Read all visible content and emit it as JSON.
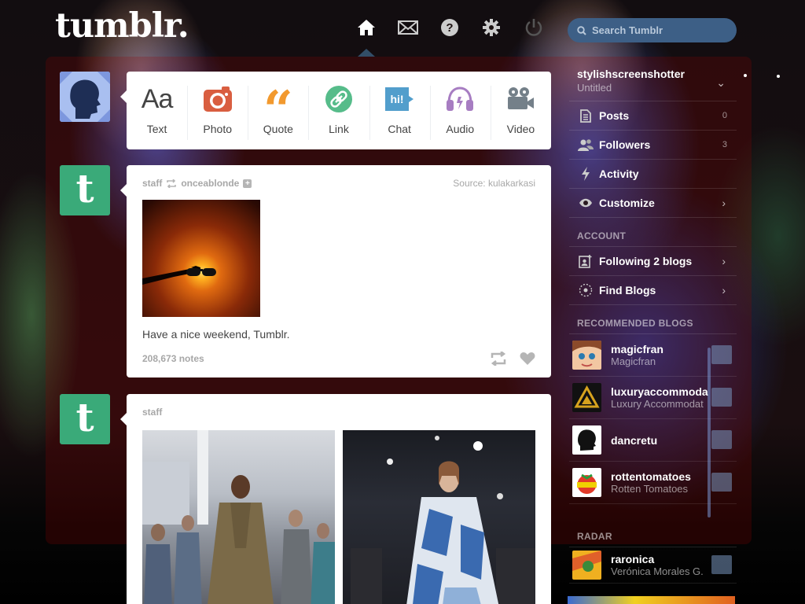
{
  "header": {
    "logo": "tumblr.",
    "search_placeholder": "Search Tumblr",
    "nav": [
      "home-icon",
      "mail-icon",
      "help-icon",
      "gear-icon",
      "power-icon"
    ]
  },
  "post_types": [
    {
      "label": "Text",
      "icon": "text-icon",
      "color": "#444444"
    },
    {
      "label": "Photo",
      "icon": "camera-icon",
      "color": "#d95e40"
    },
    {
      "label": "Quote",
      "icon": "quote-icon",
      "color": "#f2992e"
    },
    {
      "label": "Link",
      "icon": "link-icon",
      "color": "#56bc8a"
    },
    {
      "label": "Chat",
      "icon": "chat-icon",
      "color": "#529ecc"
    },
    {
      "label": "Audio",
      "icon": "audio-icon",
      "color": "#a77dc2"
    },
    {
      "label": "Video",
      "icon": "video-icon",
      "color": "#748089"
    }
  ],
  "posts": [
    {
      "author": "staff",
      "reblogged_from": "onceablonde",
      "source_label": "Source:",
      "source": "kulakarkasi",
      "caption": "Have a nice weekend, Tumblr.",
      "notes": "208,673 notes"
    },
    {
      "author": "staff"
    }
  ],
  "sidebar": {
    "blog_name": "stylishscreenshotter",
    "blog_title": "Untitled",
    "items": [
      {
        "label": "Posts",
        "count": "0",
        "icon": "posts-icon"
      },
      {
        "label": "Followers",
        "count": "3",
        "icon": "followers-icon"
      },
      {
        "label": "Activity",
        "icon": "activity-icon"
      },
      {
        "label": "Customize",
        "icon": "eye-icon"
      }
    ],
    "account_title": "ACCOUNT",
    "account_items": [
      {
        "label": "Following 2 blogs",
        "icon": "following-icon"
      },
      {
        "label": "Find Blogs",
        "icon": "compass-icon"
      }
    ],
    "recommended_title": "RECOMMENDED BLOGS",
    "recommended": [
      {
        "name": "magicfran",
        "title": "Magicfran"
      },
      {
        "name": "luxuryaccommoda",
        "title": "Luxury Accommodat"
      },
      {
        "name": "dancretu",
        "title": ""
      },
      {
        "name": "rottentomatoes",
        "title": "Rotten Tomatoes"
      }
    ],
    "radar_title": "RADAR",
    "radar": {
      "name": "raronica",
      "title": "Verónica Morales G."
    }
  },
  "colors": {
    "tumblr_green": "#3aaa79",
    "search_bg": "#3d5f86",
    "card_bg": "#ffffff"
  }
}
